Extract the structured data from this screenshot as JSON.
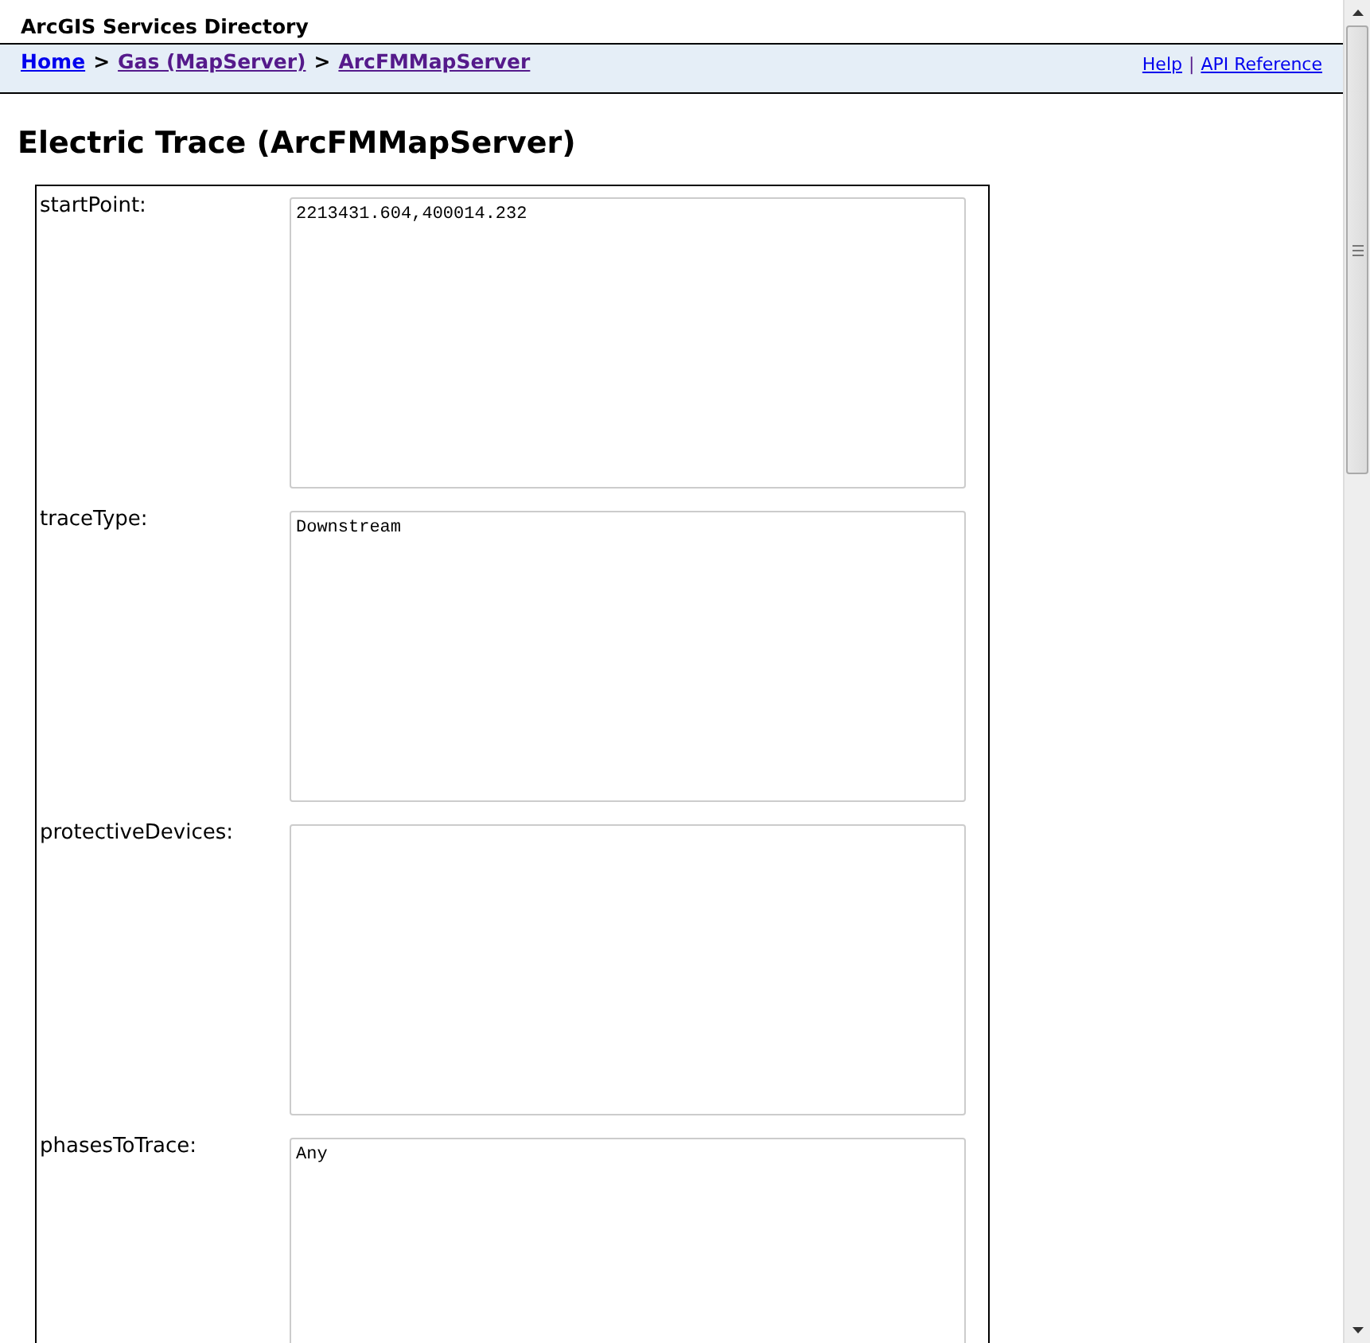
{
  "header": {
    "title": "ArcGIS Services Directory"
  },
  "breadcrumbs": [
    {
      "label": "Home",
      "visited": false
    },
    {
      "label": "Gas (MapServer)",
      "visited": true
    },
    {
      "label": "ArcFMMapServer",
      "visited": true
    }
  ],
  "breadcrumb_separator": ">",
  "nav_links": [
    {
      "label": "Help"
    },
    {
      "label": "API Reference"
    }
  ],
  "nav_separator": "|",
  "page_title": "Electric Trace (ArcFMMapServer)",
  "form": {
    "fields": [
      {
        "label": "startPoint:",
        "value": "2213431.604,400014.232"
      },
      {
        "label": "traceType:",
        "value": "Downstream"
      },
      {
        "label": "protectiveDevices:"
      },
      {
        "label": "phasesToTrace:",
        "value": "Any"
      }
    ]
  }
}
